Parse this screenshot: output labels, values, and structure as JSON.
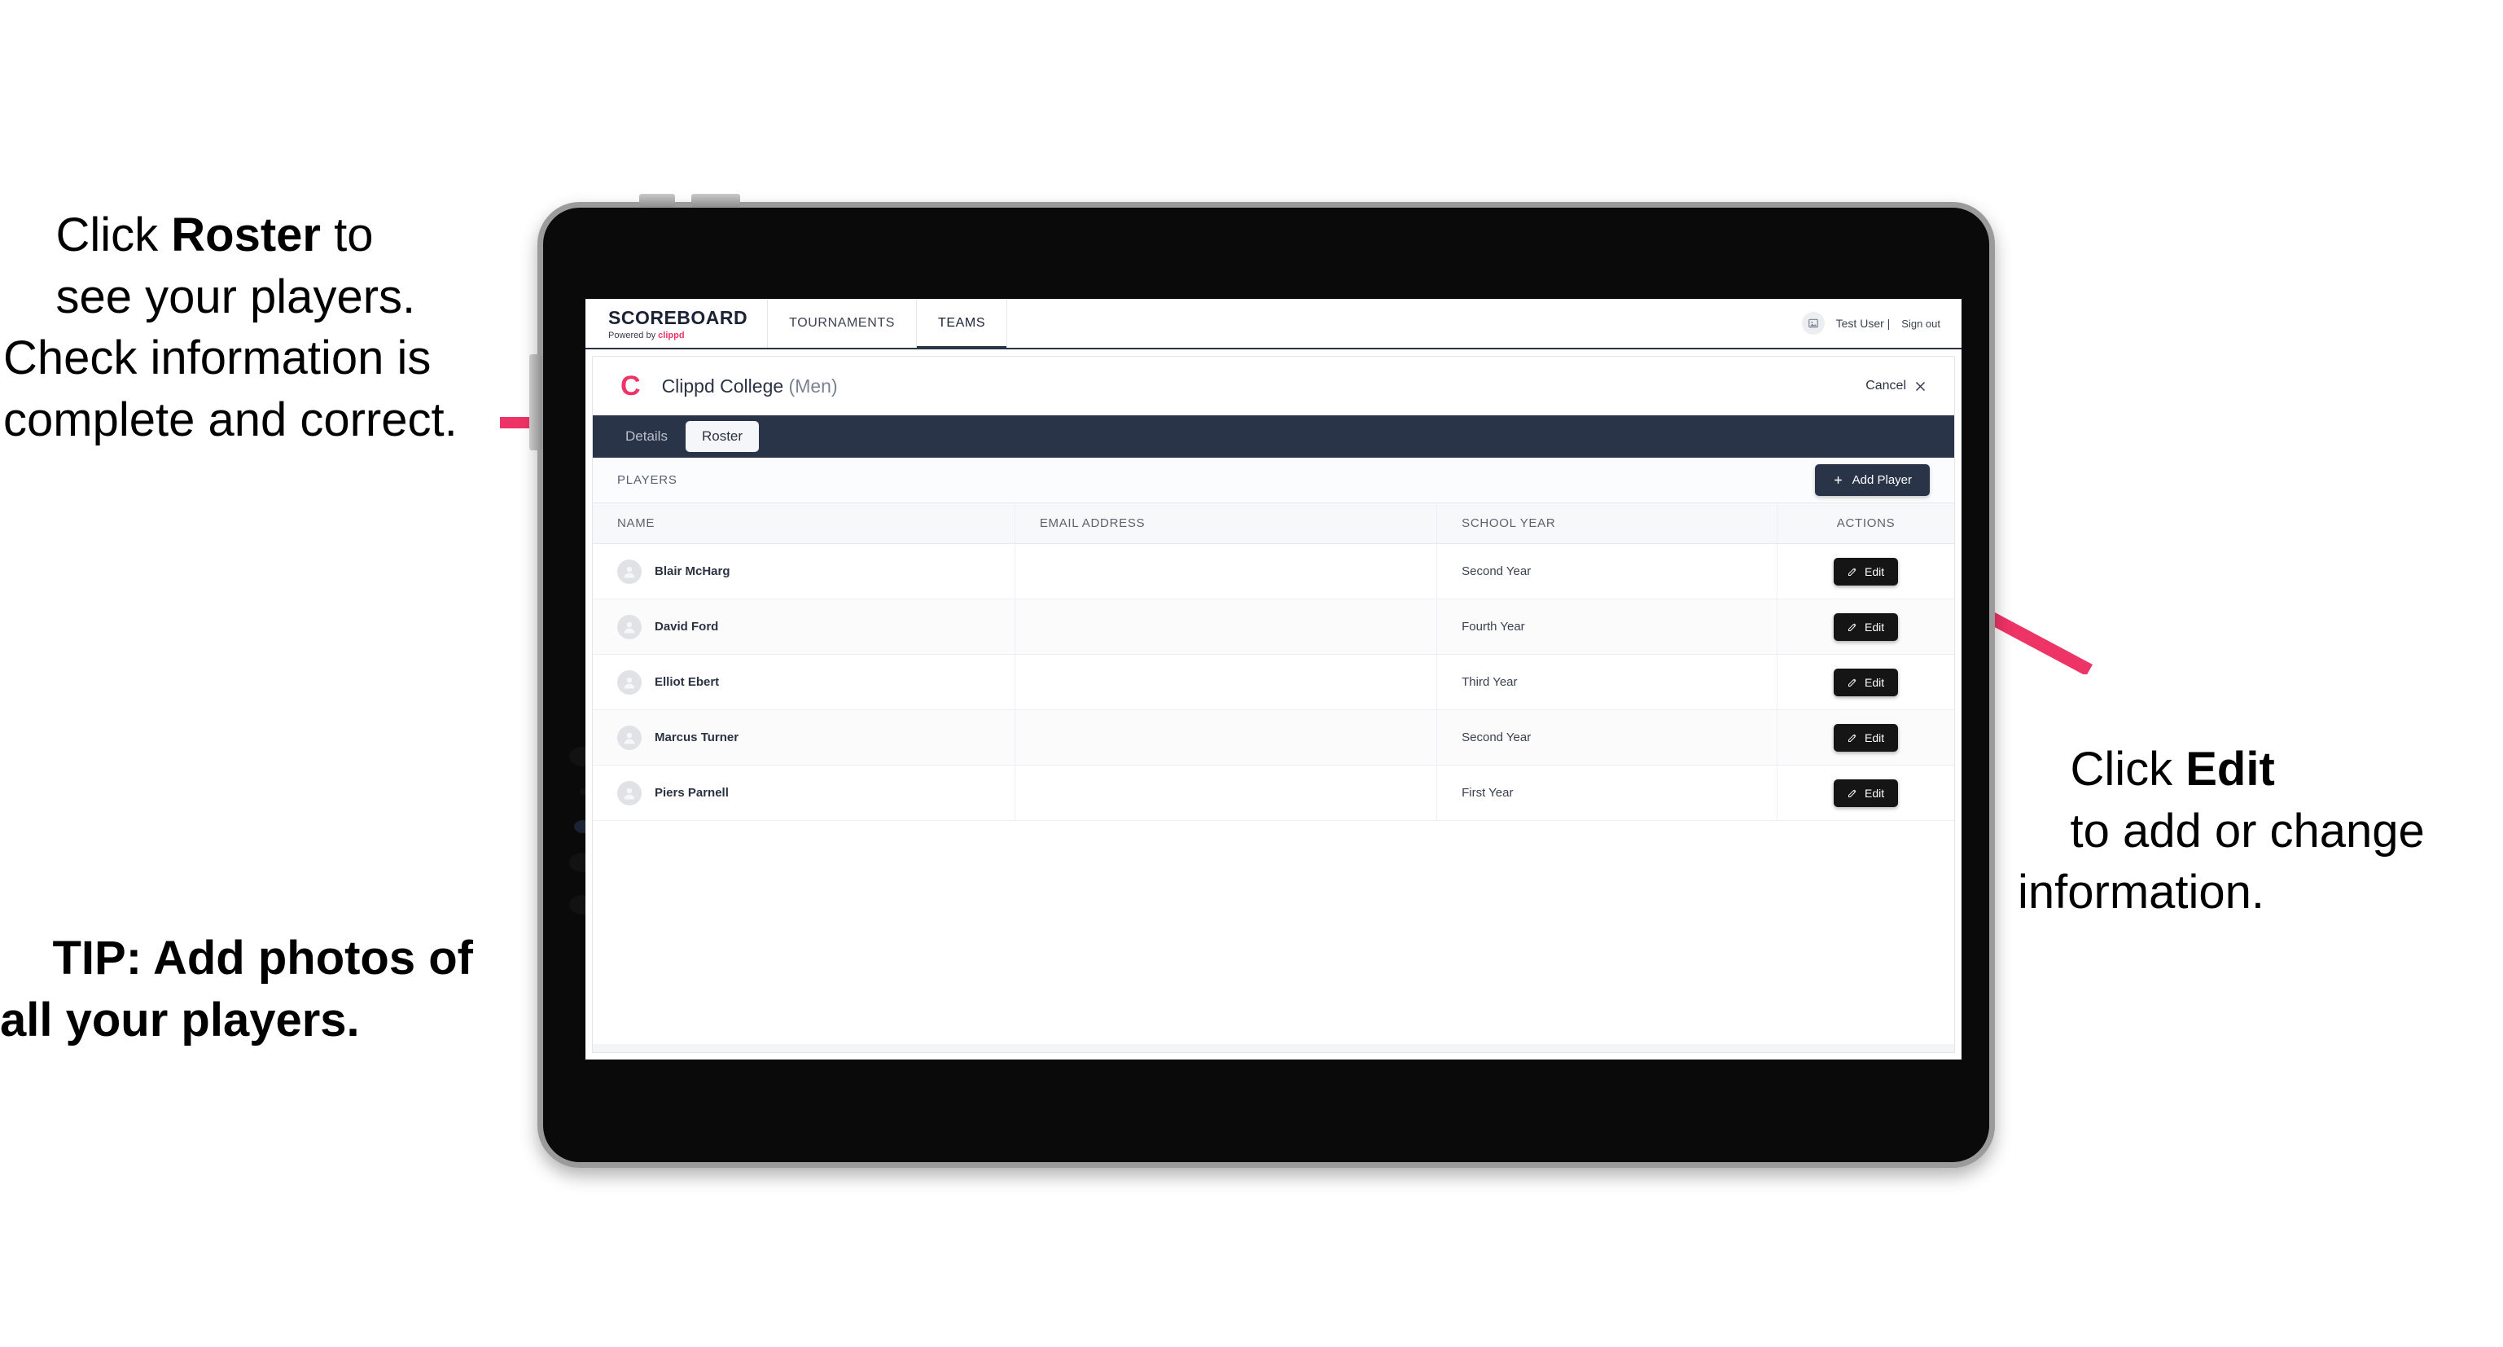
{
  "annotations": {
    "left_top": {
      "line1_pre": "Click ",
      "line1_bold": "Roster",
      "line1_post": " to",
      "rest": "see your players. Check information is complete and correct."
    },
    "left_bottom": {
      "text": "TIP: Add photos of all your players."
    },
    "right": {
      "line1_pre": "Click ",
      "line1_bold": "Edit",
      "rest": "to add or change information."
    },
    "arrow_color": "#ee3366"
  },
  "app": {
    "brand": {
      "title": "SCOREBOARD",
      "sub_prefix": "Powered by ",
      "sub_brand": "clippd"
    },
    "nav_tabs": [
      {
        "label": "TOURNAMENTS",
        "active": false
      },
      {
        "label": "TEAMS",
        "active": true
      }
    ],
    "account": {
      "avatar_icon": "image-placeholder-icon",
      "user": "Test User |",
      "sign_out": "Sign out"
    },
    "team_header": {
      "logo_letter": "C",
      "name": "Clippd College",
      "gender": "(Men)",
      "cancel_label": "Cancel",
      "cancel_icon": "close-icon"
    },
    "view_tabs": {
      "details_label": "Details",
      "roster_label": "Roster",
      "active": "Roster"
    },
    "players_section": {
      "label": "PLAYERS",
      "add_button_label": "Add Player",
      "add_button_icon": "plus-icon"
    },
    "table": {
      "columns": [
        "NAME",
        "EMAIL ADDRESS",
        "SCHOOL YEAR",
        "ACTIONS"
      ],
      "edit_label": "Edit",
      "edit_icon": "pencil-icon",
      "avatar_icon": "person-avatar-icon",
      "rows": [
        {
          "name": "Blair McHarg",
          "email": "",
          "school_year": "Second Year"
        },
        {
          "name": "David Ford",
          "email": "",
          "school_year": "Fourth Year"
        },
        {
          "name": "Elliot Ebert",
          "email": "",
          "school_year": "Third Year"
        },
        {
          "name": "Marcus Turner",
          "email": "",
          "school_year": "Second Year"
        },
        {
          "name": "Piers Parnell",
          "email": "",
          "school_year": "First Year"
        }
      ]
    },
    "colors": {
      "navy": "#2a3448",
      "accent_pink": "#ee3366",
      "dark_button": "#151515"
    }
  }
}
